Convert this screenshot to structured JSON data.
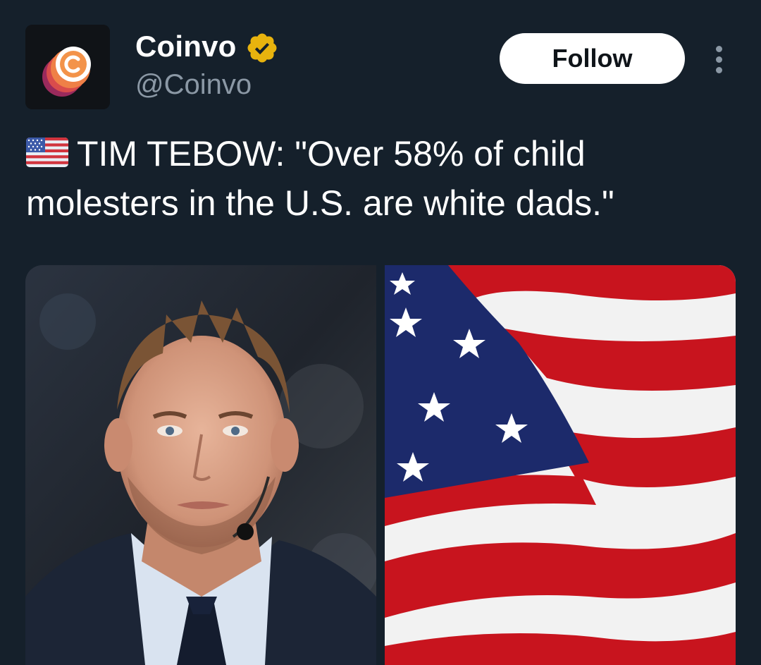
{
  "post": {
    "author": {
      "display_name": "Coinvo",
      "handle": "@Coinvo",
      "verified": true,
      "verified_badge_color": "#e8b30e",
      "avatar_icon": "coinvo-logo-icon"
    },
    "follow_label": "Follow",
    "more_icon": "more-options-icon",
    "text_emoji": "us-flag-emoji",
    "text": "TIM TEBOW: \"Over 58% of child molesters in the U.S. are white dads.\"",
    "media": [
      {
        "icon": "portrait-photo"
      },
      {
        "icon": "american-flag-photo"
      }
    ]
  },
  "theme": {
    "background": "#15202b",
    "secondary_text": "#8b98a5",
    "button_bg": "#ffffff"
  }
}
